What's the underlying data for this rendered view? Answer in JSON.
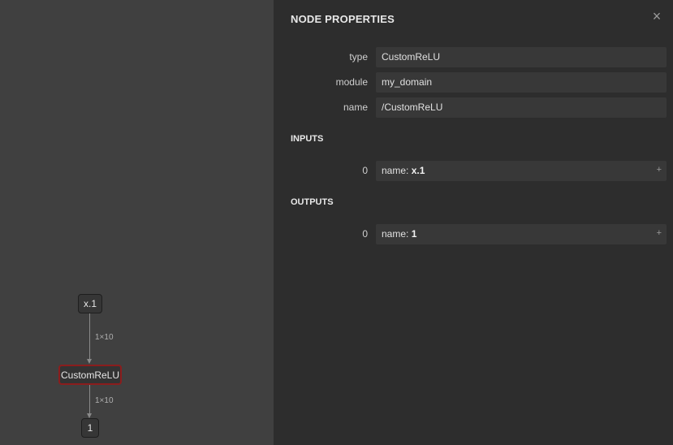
{
  "graph": {
    "input_node": "x.1",
    "op_node": "CustomReLU",
    "output_node": "1",
    "edge_label_1": "1×10",
    "edge_label_2": "1×10"
  },
  "sidebar": {
    "title": "NODE PROPERTIES",
    "close_icon": "×",
    "properties": [
      {
        "label": "type",
        "value": "CustomReLU"
      },
      {
        "label": "module",
        "value": "my_domain"
      },
      {
        "label": "name",
        "value": "/CustomReLU"
      }
    ],
    "inputs_heading": "INPUTS",
    "inputs": [
      {
        "index": "0",
        "name_prefix": "name: ",
        "name": "x.1",
        "expand": "+"
      }
    ],
    "outputs_heading": "OUTPUTS",
    "outputs": [
      {
        "index": "0",
        "name_prefix": "name: ",
        "name": "1",
        "expand": "+"
      }
    ]
  }
}
